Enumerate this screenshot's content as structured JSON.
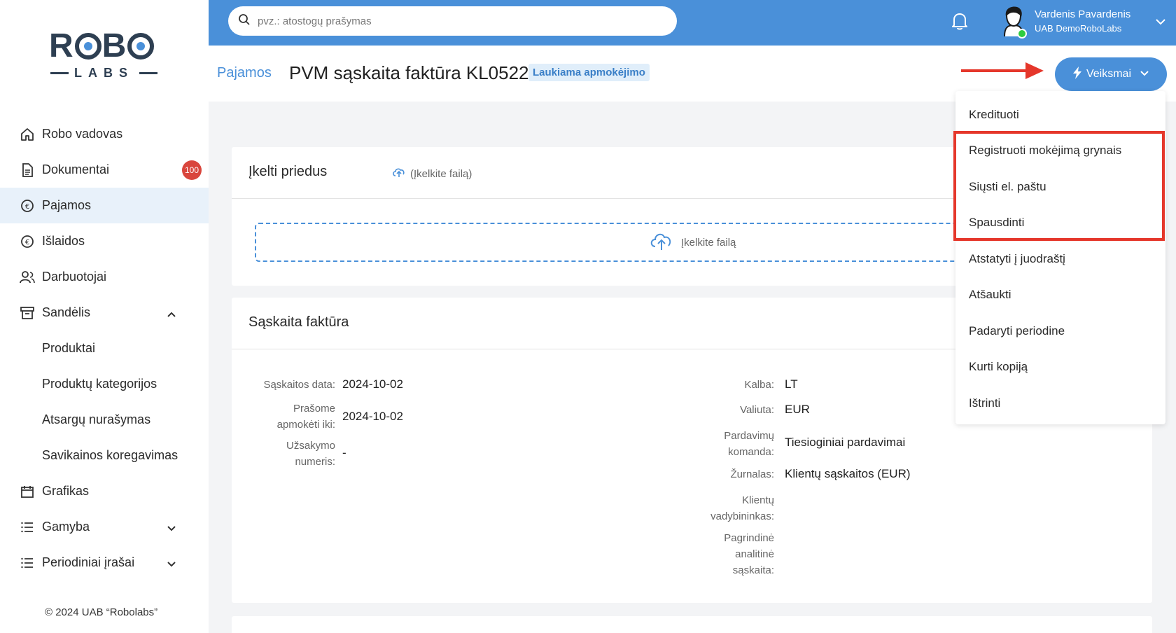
{
  "logo": {
    "top": "ROBO",
    "bottom": "LABS"
  },
  "sidebar": {
    "items": [
      {
        "label": "Robo vadovas",
        "icon": "home-icon"
      },
      {
        "label": "Dokumentai",
        "icon": "document-icon",
        "badge": "100"
      },
      {
        "label": "Pajamos",
        "icon": "income-icon",
        "active": true
      },
      {
        "label": "Išlaidos",
        "icon": "expense-icon"
      },
      {
        "label": "Darbuotojai",
        "icon": "users-icon"
      },
      {
        "label": "Sandėlis",
        "icon": "archive-icon",
        "expanded": true
      },
      {
        "label": "Produktai",
        "sub": true
      },
      {
        "label": "Produktų kategorijos",
        "sub": true
      },
      {
        "label": "Atsargų nurašymas",
        "sub": true
      },
      {
        "label": "Savikainos koregavimas",
        "sub": true
      },
      {
        "label": "Grafikas",
        "icon": "calendar-icon"
      },
      {
        "label": "Gamyba",
        "icon": "list-icon"
      },
      {
        "label": "Periodiniai įrašai",
        "icon": "list-icon"
      }
    ],
    "copyright": "© 2024 UAB “Robolabs”"
  },
  "topbar": {
    "search_placeholder": "pvz.: atostogų prašymas",
    "user_name": "Vardenis Pavardenis",
    "user_company": "UAB DemoRoboLabs",
    "online_color": "#2ecc40"
  },
  "header": {
    "breadcrumb": "Pajamos",
    "title": "PVM sąskaita faktūra KL0522",
    "status": "Laukiama apmokėjimo",
    "actions_label": "Veiksmai"
  },
  "attachments": {
    "title": "Įkelti priedus",
    "upload_link": "(Įkelkite failą)",
    "dropzone_text": "Įkelkite failą"
  },
  "invoice": {
    "title": "Sąskaita faktūra",
    "left_fields": [
      {
        "label": "Sąskaitos data:",
        "value": "2024-10-02"
      },
      {
        "label": "Prašome apmokėti iki:",
        "value": "2024-10-02"
      },
      {
        "label": "Užsakymo numeris:",
        "value": "-"
      }
    ],
    "right_fields": [
      {
        "label": "Kalba:",
        "value": "LT"
      },
      {
        "label": "Valiuta:",
        "value": "EUR"
      },
      {
        "label": "Pardavimų komanda:",
        "value": "Tiesioginiai pardavimai"
      },
      {
        "label": "Žurnalas:",
        "value": "Klientų sąskaitos (EUR)"
      },
      {
        "label": "Klientų vadybininkas:",
        "value": ""
      },
      {
        "label": "Pagrindinė analitinė sąskaita:",
        "value": ""
      }
    ]
  },
  "actions_menu": [
    "Kredituoti",
    "Registruoti mokėjimą grynais",
    "Siųsti el. paštu",
    "Spausdinti",
    "Atstatyti į juodraštį",
    "Atšaukti",
    "Padaryti periodine",
    "Kurti kopiją",
    "Ištrinti"
  ],
  "colors": {
    "accent": "#4a90d9",
    "highlight": "#e5372b",
    "badge": "#d9463d"
  }
}
